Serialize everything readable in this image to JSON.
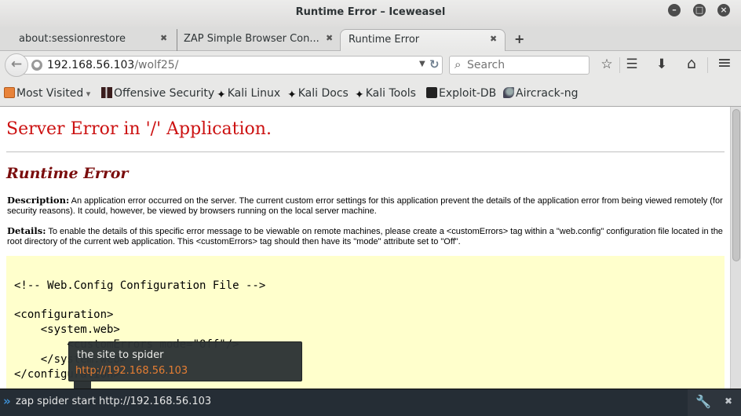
{
  "window": {
    "title": "Runtime Error – Iceweasel",
    "controls": {
      "minimize": "–",
      "maximize": "□",
      "close": "×"
    }
  },
  "tabs": [
    {
      "label": "about:sessionrestore",
      "active": false,
      "close": "✖"
    },
    {
      "label": "ZAP Simple Browser Con...",
      "active": false,
      "close": "✖"
    },
    {
      "label": "Runtime Error",
      "active": true,
      "close": "✖"
    }
  ],
  "new_tab": "+",
  "navbar": {
    "back_icon": "←",
    "site_icon": "globe-icon",
    "url_host": "192.168.56.103",
    "url_path": "/wolf25/",
    "dropdown_icon": "▼",
    "reload_icon": "↻",
    "search_placeholder": "Search",
    "search_icon": "⚲",
    "icons": {
      "bookmark_star": "☆",
      "reading_list": "☰",
      "downloads": "⬇",
      "home": "⌂",
      "menu": "≡"
    }
  },
  "bookmarks": [
    {
      "label": "Most Visited",
      "icon": "folder-icon",
      "suffix": " ▾"
    },
    {
      "label": "Offensive Security",
      "icon": "offensive-security-icon"
    },
    {
      "label": "Kali Linux",
      "icon": "kali-dragon-icon",
      "glyph": "✦"
    },
    {
      "label": "Kali Docs",
      "icon": "kali-dragon-icon",
      "glyph": "✦"
    },
    {
      "label": "Kali Tools",
      "icon": "kali-dragon-icon",
      "glyph": "✦"
    },
    {
      "label": "Exploit-DB",
      "icon": "exploit-db-icon"
    },
    {
      "label": "Aircrack-ng",
      "icon": "aircrack-icon"
    }
  ],
  "page": {
    "heading": "Server Error in '/' Application.",
    "subheading": "Runtime Error",
    "description_label": "Description:",
    "description_text": " An application error occurred on the server. The current custom error settings for this application prevent the details of the application error from being viewed remotely (for security reasons). It could, however, be viewed by browsers running on the local server machine.",
    "details_label": "Details:",
    "details_text": " To enable the details of this specific error message to be viewable on remote machines, please create a <customErrors> tag within a \"web.config\" configuration file located in the root directory of the current web application. This <customErrors> tag should then have its \"mode\" attribute set to \"Off\".",
    "code_lines": [
      "<!-- Web.Config Configuration File -->",
      "",
      "<configuration>",
      "    <system.web>",
      "        <customErrors mode=\"Off\"/>",
      "    </system.web>",
      "</configuration>"
    ]
  },
  "tooltip": {
    "label": "the site to spider",
    "value": "http://192.168.56.103"
  },
  "command_bar": {
    "prompt": "»",
    "value": "zap spider start http://192.168.56.103",
    "tools_icon": "🔧",
    "close_icon": "✖"
  }
}
